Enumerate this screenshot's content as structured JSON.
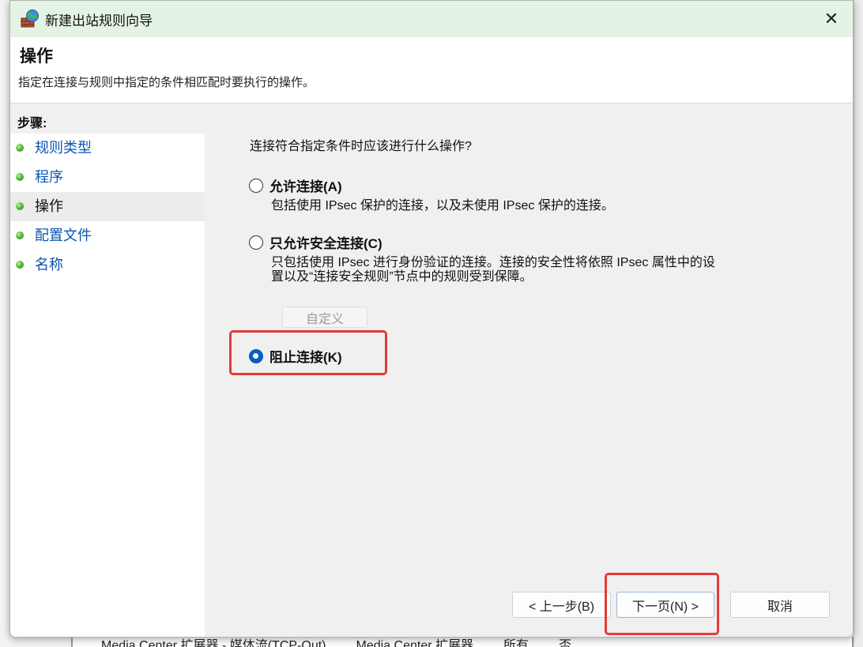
{
  "window": {
    "title": "新建出站规则向导",
    "close_glyph": "✕"
  },
  "header": {
    "title": "操作",
    "description": "指定在连接与规则中指定的条件相匹配时要执行的操作。"
  },
  "sidebar": {
    "heading": "步骤:",
    "items": [
      {
        "label": "规则类型",
        "current": false
      },
      {
        "label": "程序",
        "current": false
      },
      {
        "label": "操作",
        "current": true
      },
      {
        "label": "配置文件",
        "current": false
      },
      {
        "label": "名称",
        "current": false
      }
    ]
  },
  "main": {
    "question": "连接符合指定条件时应该进行什么操作?",
    "options": [
      {
        "label": "允许连接(A)",
        "description": "包括使用 IPsec 保护的连接，以及未使用 IPsec 保护的连接。",
        "checked": false
      },
      {
        "label": "只允许安全连接(C)",
        "description_line1": "只包括使用 IPsec 进行身份验证的连接。连接的安全性将依照 IPsec 属性中的设",
        "description_line2": "置以及“连接安全规则”节点中的规则受到保障。",
        "checked": false
      },
      {
        "label": "阻止连接(K)",
        "checked": true
      }
    ],
    "customize_button": "自定义"
  },
  "footer": {
    "back_button": "< 上一步(B)",
    "next_button": "下一页(N) >",
    "cancel_button": "取消"
  },
  "background": {
    "row_cells": [
      "Media Center 扩展器 - 媒体流(TCP-Out)",
      "Media Center 扩展器",
      "所有",
      "否"
    ]
  },
  "colors": {
    "titlebar_bg": "#e4f4e4",
    "link": "#0a55b5",
    "highlight": "#e53a3a",
    "radio_selected": "#0b5cc4"
  }
}
